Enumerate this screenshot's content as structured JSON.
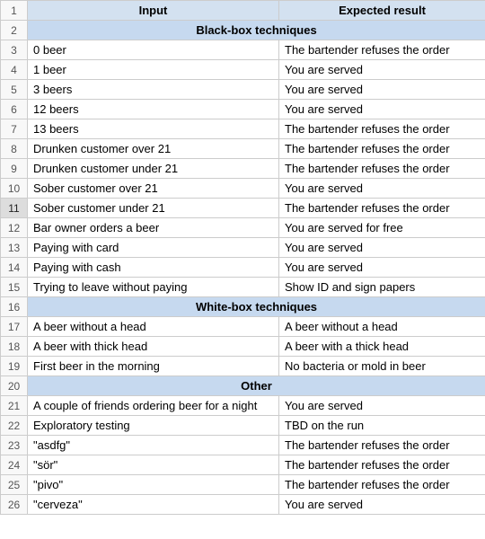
{
  "headers": {
    "input": "Input",
    "expected": "Expected result"
  },
  "sections": {
    "black_box": "Black-box techniques",
    "white_box": "White-box techniques",
    "other": "Other"
  },
  "rows": [
    {
      "num": "1",
      "kind": "header"
    },
    {
      "num": "2",
      "kind": "section",
      "section_key": "black_box"
    },
    {
      "num": "3",
      "kind": "data",
      "input": "0 beer",
      "expected": "The bartender refuses the order"
    },
    {
      "num": "4",
      "kind": "data",
      "input": "1 beer",
      "expected": "You are served"
    },
    {
      "num": "5",
      "kind": "data",
      "input": "3 beers",
      "expected": "You are served"
    },
    {
      "num": "6",
      "kind": "data",
      "input": "12 beers",
      "expected": "You are served"
    },
    {
      "num": "7",
      "kind": "data",
      "input": "13 beers",
      "expected": "The bartender refuses the order"
    },
    {
      "num": "8",
      "kind": "data",
      "input": "Drunken customer over 21",
      "expected": "The bartender refuses the order"
    },
    {
      "num": "9",
      "kind": "data",
      "input": "Drunken customer under 21",
      "expected": "The bartender refuses the order"
    },
    {
      "num": "10",
      "kind": "data",
      "input": "Sober customer over 21",
      "expected": "You are served"
    },
    {
      "num": "11",
      "kind": "data",
      "input": "Sober customer under 21",
      "expected": "The bartender refuses the order",
      "selected": true
    },
    {
      "num": "12",
      "kind": "data",
      "input": "Bar owner orders a beer",
      "expected": "You are served for free"
    },
    {
      "num": "13",
      "kind": "data",
      "input": "Paying with card",
      "expected": "You are served"
    },
    {
      "num": "14",
      "kind": "data",
      "input": "Paying with cash",
      "expected": "You are served"
    },
    {
      "num": "15",
      "kind": "data",
      "input": "Trying to leave without paying",
      "expected": "Show ID and sign papers"
    },
    {
      "num": "16",
      "kind": "section",
      "section_key": "white_box"
    },
    {
      "num": "17",
      "kind": "data",
      "input": "A beer without a head",
      "expected": "A beer without a head"
    },
    {
      "num": "18",
      "kind": "data",
      "input": "A beer with thick head",
      "expected": "A beer with a thick head"
    },
    {
      "num": "19",
      "kind": "data",
      "input": "First beer in the morning",
      "expected": "No bacteria or mold in beer"
    },
    {
      "num": "20",
      "kind": "section",
      "section_key": "other"
    },
    {
      "num": "21",
      "kind": "data",
      "input": "A couple of friends ordering beer for a night",
      "expected": "You are served"
    },
    {
      "num": "22",
      "kind": "data",
      "input": "Exploratory testing",
      "expected": "TBD on the run"
    },
    {
      "num": "23",
      "kind": "data",
      "input": "\"asdfg\"",
      "expected": "The bartender refuses the order"
    },
    {
      "num": "24",
      "kind": "data",
      "input": "\"sör\"",
      "expected": "The bartender refuses the order"
    },
    {
      "num": "25",
      "kind": "data",
      "input": "\"pivo\"",
      "expected": "The bartender refuses the order"
    },
    {
      "num": "26",
      "kind": "data",
      "input": "\"cerveza\"",
      "expected": "You are served"
    }
  ]
}
